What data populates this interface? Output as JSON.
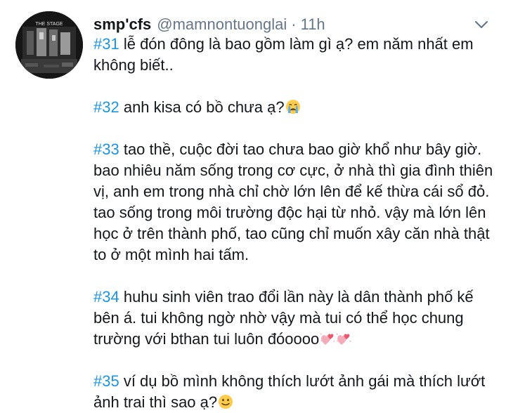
{
  "tweet": {
    "display_name": "smp'cfs",
    "handle": "@mamnontuonglai",
    "separator": "·",
    "time": "11h",
    "avatar_text": "THE STAGE",
    "paragraphs": [
      {
        "hashtag": "#31",
        "text": " lễ đón đông là bao gồm làm gì ạ? em năm nhất em không biết..",
        "emoji": []
      },
      {
        "hashtag": "#32",
        "text": " anh kisa có bồ chưa ạ?",
        "emoji": [
          "crying-face"
        ]
      },
      {
        "hashtag": "#33",
        "text": " tao thề, cuộc đời tao chưa bao giờ khổ như bây giờ. bao nhiêu năm sống trong cơ cực, ở nhà thì gia đình thiên vị, anh em trong nhà chỉ chờ lớn lên để kế thừa cái sổ đỏ. tao sống trong môi trường độc hại từ nhỏ. vậy mà lớn lên học ở trên thành phố, tao cũng chỉ muốn xây căn nhà thật to ở một mình hai tấm.",
        "emoji": []
      },
      {
        "hashtag": "#34",
        "text": " huhu sinh viên trao đổi lần này là dân thành phố kế bên á. tui không ngờ nhờ vậy mà tui có thể học chung trường với bthan tui luôn đóoooo",
        "emoji": [
          "two-hearts",
          "two-hearts"
        ]
      },
      {
        "hashtag": "#35",
        "text": " ví dụ bồ mình không thích lướt ảnh gái mà thích lướt ảnh trai thì sao ạ?",
        "emoji": [
          "slightly-smiling-face"
        ]
      }
    ]
  },
  "colors": {
    "hashtag": "#1b95e0",
    "muted": "#657786",
    "text": "#14171a"
  },
  "icons": {
    "more": "chevron-down-icon"
  }
}
